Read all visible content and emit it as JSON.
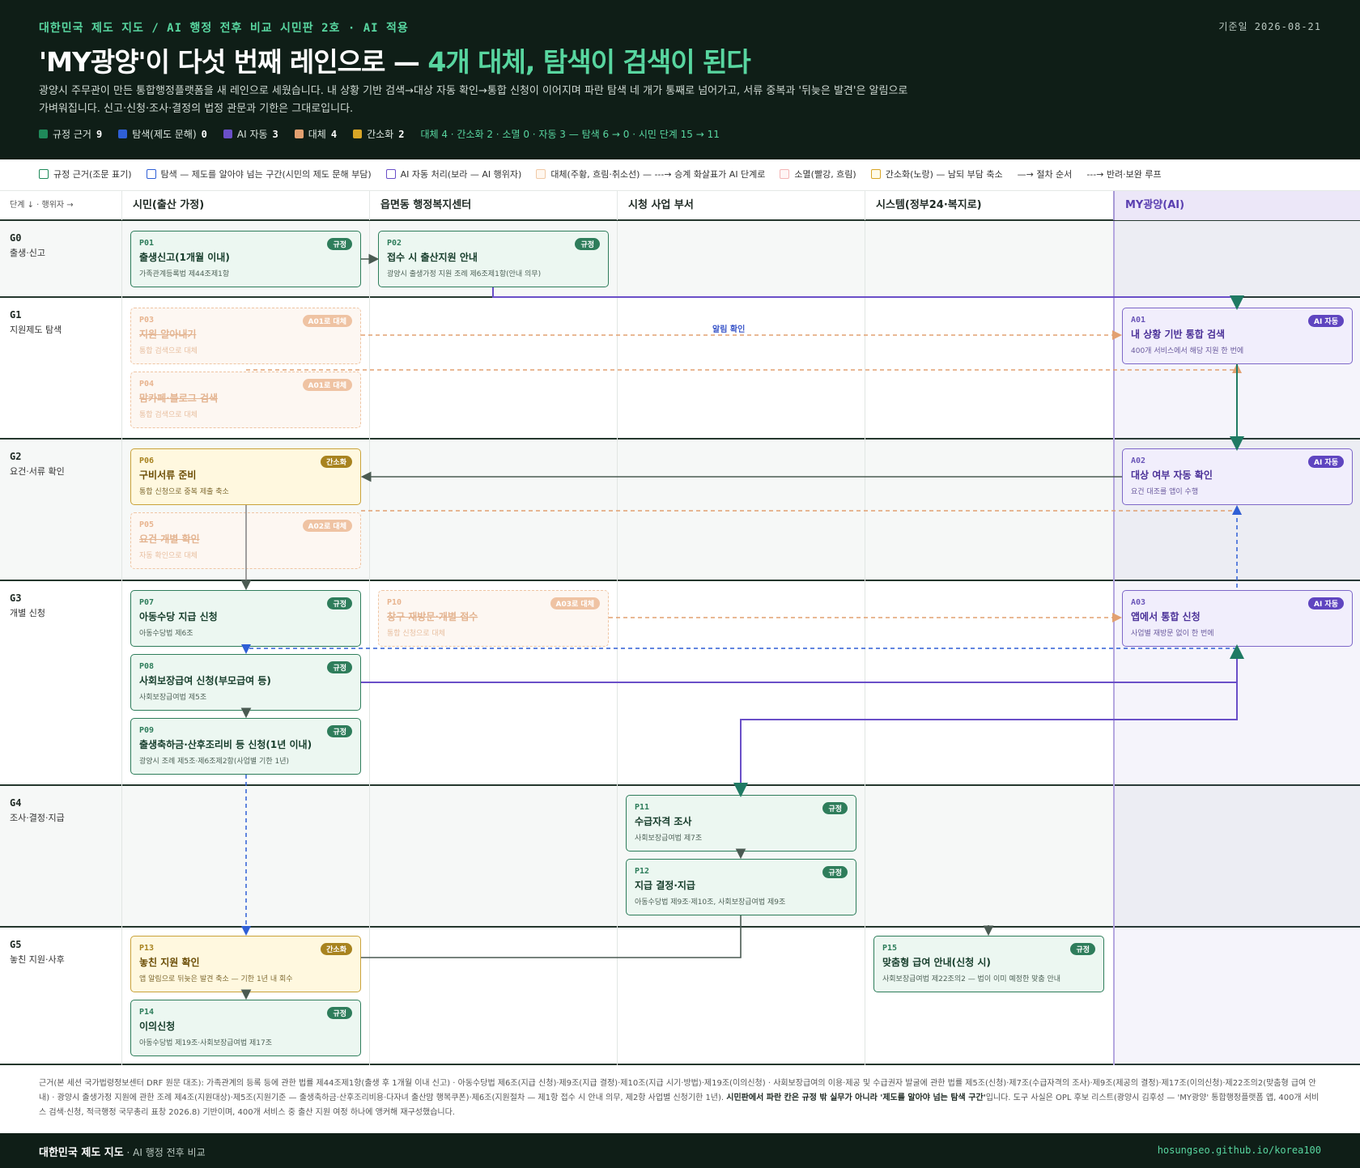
{
  "header": {
    "kicker": "대한민국 제도 지도 / AI 행정 전후 비교 시민판 2호 · AI 적용",
    "date": "기준일 2026-08-21",
    "title_a": "'MY광양'이 다섯 번째 레인으로 — ",
    "title_b": "4개 대체, 탐색이 검색이 된다",
    "desc": "광양시 주무관이 만든 통합행정플랫폼을 새 레인으로 세웠습니다. 내 상황 기반 검색→대상 자동 확인→통합 신청이 이어지며 파란 탐색 네 개가 통째로 넘어가고, 서류 중복과 '뒤늦은 발견'은 알림으로 가벼워집니다. 신고·신청·조사·결정의 법정 관문과 기한은 그대로입니다.",
    "stats": [
      {
        "label": "규정 근거",
        "value": "9",
        "color": "#1f8a5a"
      },
      {
        "label": "탐색(제도 문해)",
        "value": "0",
        "color": "#2f5fd6"
      },
      {
        "label": "AI 자동",
        "value": "3",
        "color": "#6a4fc8"
      },
      {
        "label": "대체",
        "value": "4",
        "color": "#e2a070"
      },
      {
        "label": "간소화",
        "value": "2",
        "color": "#d8a526"
      }
    ],
    "summary": "대체 4 · 간소화 2 · 소멸 0 · 자동 3 — 탐색 6 → 0 · 시민 단계 15 → 11"
  },
  "legend": [
    {
      "label": "규정 근거(조문 표기)",
      "border": "#1f8a5a",
      "fill": "#ffffff"
    },
    {
      "label": "탐색 — 제도를 알아야 넘는 구간(시민의 제도 문해 부담)",
      "border": "#2f5fd6",
      "fill": "#ffffff"
    },
    {
      "label": "AI 자동 처리(보라 — AI 행위자)",
      "border": "#6a4fc8",
      "fill": "#ffffff"
    },
    {
      "label": "대체(주황, 흐림·취소선) — ---→ 승계 화살표가 AI 단계로",
      "border": "#f0c9a6",
      "fill": "#fff7ef"
    },
    {
      "label": "소멸(빨강, 흐림)",
      "border": "#f3b6b6",
      "fill": "#fff5f5"
    },
    {
      "label": "간소화(노랑) — 남되 부담 축소",
      "border": "#d8a526",
      "fill": "#fffbe8"
    }
  ],
  "legend_arrows": [
    "—→ 절차 순서",
    "---→ 반려·보완 루프"
  ],
  "columns": {
    "corner": "단계 ↓ · 행위자 →",
    "lanes": [
      "시민(출산 가정)",
      "읍면동 행정복지센터",
      "시청 사업 부서",
      "시스템(정부24·복지로)",
      "MY광양(AI)"
    ]
  },
  "rows": [
    {
      "code": "G0",
      "name": "출생·신고"
    },
    {
      "code": "G1",
      "name": "지원제도 탐색"
    },
    {
      "code": "G2",
      "name": "요건·서류 확인"
    },
    {
      "code": "G3",
      "name": "개별 신청"
    },
    {
      "code": "G4",
      "name": "조사·결정·지급"
    },
    {
      "code": "G5",
      "name": "놓친 지원·사후"
    }
  ],
  "cards": {
    "P01": {
      "id": "P01",
      "title": "출생신고(1개월 이내)",
      "sub": "가족관계등록법 제44조제1항",
      "badge": "규정"
    },
    "P02": {
      "id": "P02",
      "title": "접수 시 출산지원 안내",
      "sub": "광양시 출생가정 지원 조례 제6조제1항(안내 의무)",
      "badge": "규정"
    },
    "P03": {
      "id": "P03",
      "title": "지원 알아내기",
      "sub": "통합 검색으로 대체",
      "badge": "A01로 대체"
    },
    "P04": {
      "id": "P04",
      "title": "맘카페·블로그 검색",
      "sub": "통합 검색으로 대체",
      "badge": "A01로 대체"
    },
    "A01": {
      "id": "A01",
      "title": "내 상황 기반 통합 검색",
      "sub": "400개 서비스에서 해당 지원 한 번에",
      "badge": "AI 자동"
    },
    "P06": {
      "id": "P06",
      "title": "구비서류 준비",
      "sub": "통합 신청으로 중복 제출 축소",
      "badge": "간소화"
    },
    "P05": {
      "id": "P05",
      "title": "요건 개별 확인",
      "sub": "자동 확인으로 대체",
      "badge": "A02로 대체"
    },
    "A02": {
      "id": "A02",
      "title": "대상 여부 자동 확인",
      "sub": "요건 대조를 앱이 수행",
      "badge": "AI 자동"
    },
    "P07": {
      "id": "P07",
      "title": "아동수당 지급 신청",
      "sub": "아동수당법 제6조",
      "badge": "규정"
    },
    "P10": {
      "id": "P10",
      "title": "창구 재방문·개별 접수",
      "sub": "통합 신청으로 대체",
      "badge": "A03로 대체"
    },
    "A03": {
      "id": "A03",
      "title": "앱에서 통합 신청",
      "sub": "사업별 재방문 없이 한 번에",
      "badge": "AI 자동"
    },
    "P08": {
      "id": "P08",
      "title": "사회보장급여 신청(부모급여 등)",
      "sub": "사회보장급여법 제5조",
      "badge": "규정"
    },
    "P09": {
      "id": "P09",
      "title": "출생축하금·산후조리비 등 신청(1년 이내)",
      "sub": "광양시 조례 제5조·제6조제2항(사업별 기한 1년)",
      "badge": "규정"
    },
    "P11": {
      "id": "P11",
      "title": "수급자격 조사",
      "sub": "사회보장급여법 제7조",
      "badge": "규정"
    },
    "P12": {
      "id": "P12",
      "title": "지급 결정·지급",
      "sub": "아동수당법 제9조·제10조, 사회보장급여법 제9조",
      "badge": "규정"
    },
    "P13": {
      "id": "P13",
      "title": "놓친 지원 확인",
      "sub": "앱 알림으로 뒤늦은 발견 축소 — 기한 1년 내 회수",
      "badge": "간소화"
    },
    "P14": {
      "id": "P14",
      "title": "이의신청",
      "sub": "아동수당법 제19조·사회보장급여법 제17조",
      "badge": "규정"
    },
    "P15": {
      "id": "P15",
      "title": "맞춤형 급여 안내(신청 시)",
      "sub": "사회보장급여법 제22조의2 — 법이 이미 예정한 맞춤 안내",
      "badge": "규정"
    }
  },
  "connector_label": "알림 확인",
  "basis": {
    "text": "근거(본 세션 국가법령정보센터 DRF 원문 대조): 가족관계의 등록 등에 관한 법률 제44조제1항(출생 후 1개월 이내 신고) · 아동수당법 제6조(지급 신청)·제9조(지급 결정)·제10조(지급 시기·방법)·제19조(이의신청) · 사회보장급여의 이용·제공 및 수급권자 발굴에 관한 법률 제5조(신청)·제7조(수급자격의 조사)·제9조(제공의 결정)·제17조(이의신청)·제22조의2(맞춤형 급여 안내) · 광양시 출생가정 지원에 관한 조례 제4조(지원대상)·제5조(지원기준 — 출생축하금·산후조리비용·다자녀 출산맘 행복쿠폰)·제6조(지원절차 — 제1항 접수 시 안내 의무, 제2항 사업별 신청기한 1년). ",
    "bold": "시민판에서 파란 칸은 규정 밖 실무가 아니라 '제도를 알아야 넘는 탐색 구간'",
    "tail": "입니다. 도구 사실은 OPL 후보 리스트(광양시 김후성 — 'MY광양' 통합행정플랫폼 앱, 400개 서비스 검색·신청, 적극행정 국무총리 표창 2026.8) 기반이며, 400개 서비스 중 출산 지원 여정 하나에 앵커해 재구성했습니다."
  },
  "footer": {
    "brand": "대한민국 제도 지도",
    "sub": " · AI 행정 전후 비교",
    "url": "hosungseo.github.io/korea100"
  },
  "colors": {
    "dark": "#0f1e17",
    "accent": "#58d6a0",
    "rule": "#1f8a5a",
    "ai": "#6a4fc8",
    "replace": "#e2a070",
    "simplify": "#d8a526",
    "explore": "#2f5fd6"
  }
}
